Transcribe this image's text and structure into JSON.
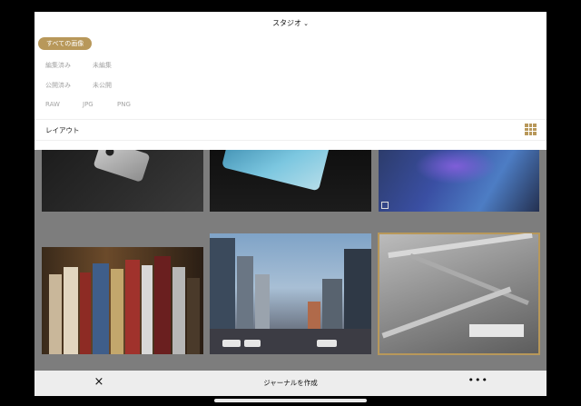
{
  "header": {
    "title": "スタジオ",
    "title_chevron": "chevron-down-icon"
  },
  "filters": {
    "selected": "すべての画像",
    "row1": [
      "編集済み",
      "未編集"
    ],
    "row2": [
      "公開済み",
      "未公開"
    ],
    "row3": [
      "RAW",
      "JPG",
      "PNG"
    ]
  },
  "layout": {
    "label": "レイアウト",
    "icon": "grid-icon"
  },
  "toolbar": {
    "close_symbol": "×",
    "create_label": "ジャーナルを作成",
    "more_symbol": "•••"
  },
  "photos": [
    {
      "name": "photo-iphone",
      "selected": false
    },
    {
      "name": "photo-ipad",
      "selected": false
    },
    {
      "name": "photo-phone-blue",
      "selected": false
    },
    {
      "name": "photo-books",
      "selected": false
    },
    {
      "name": "photo-city-street",
      "selected": false
    },
    {
      "name": "photo-atrium",
      "selected": true
    }
  ],
  "colors": {
    "accent": "#b8985a",
    "dim_overlay": "#7d7d7d",
    "toolbar_bg": "#ededed"
  }
}
